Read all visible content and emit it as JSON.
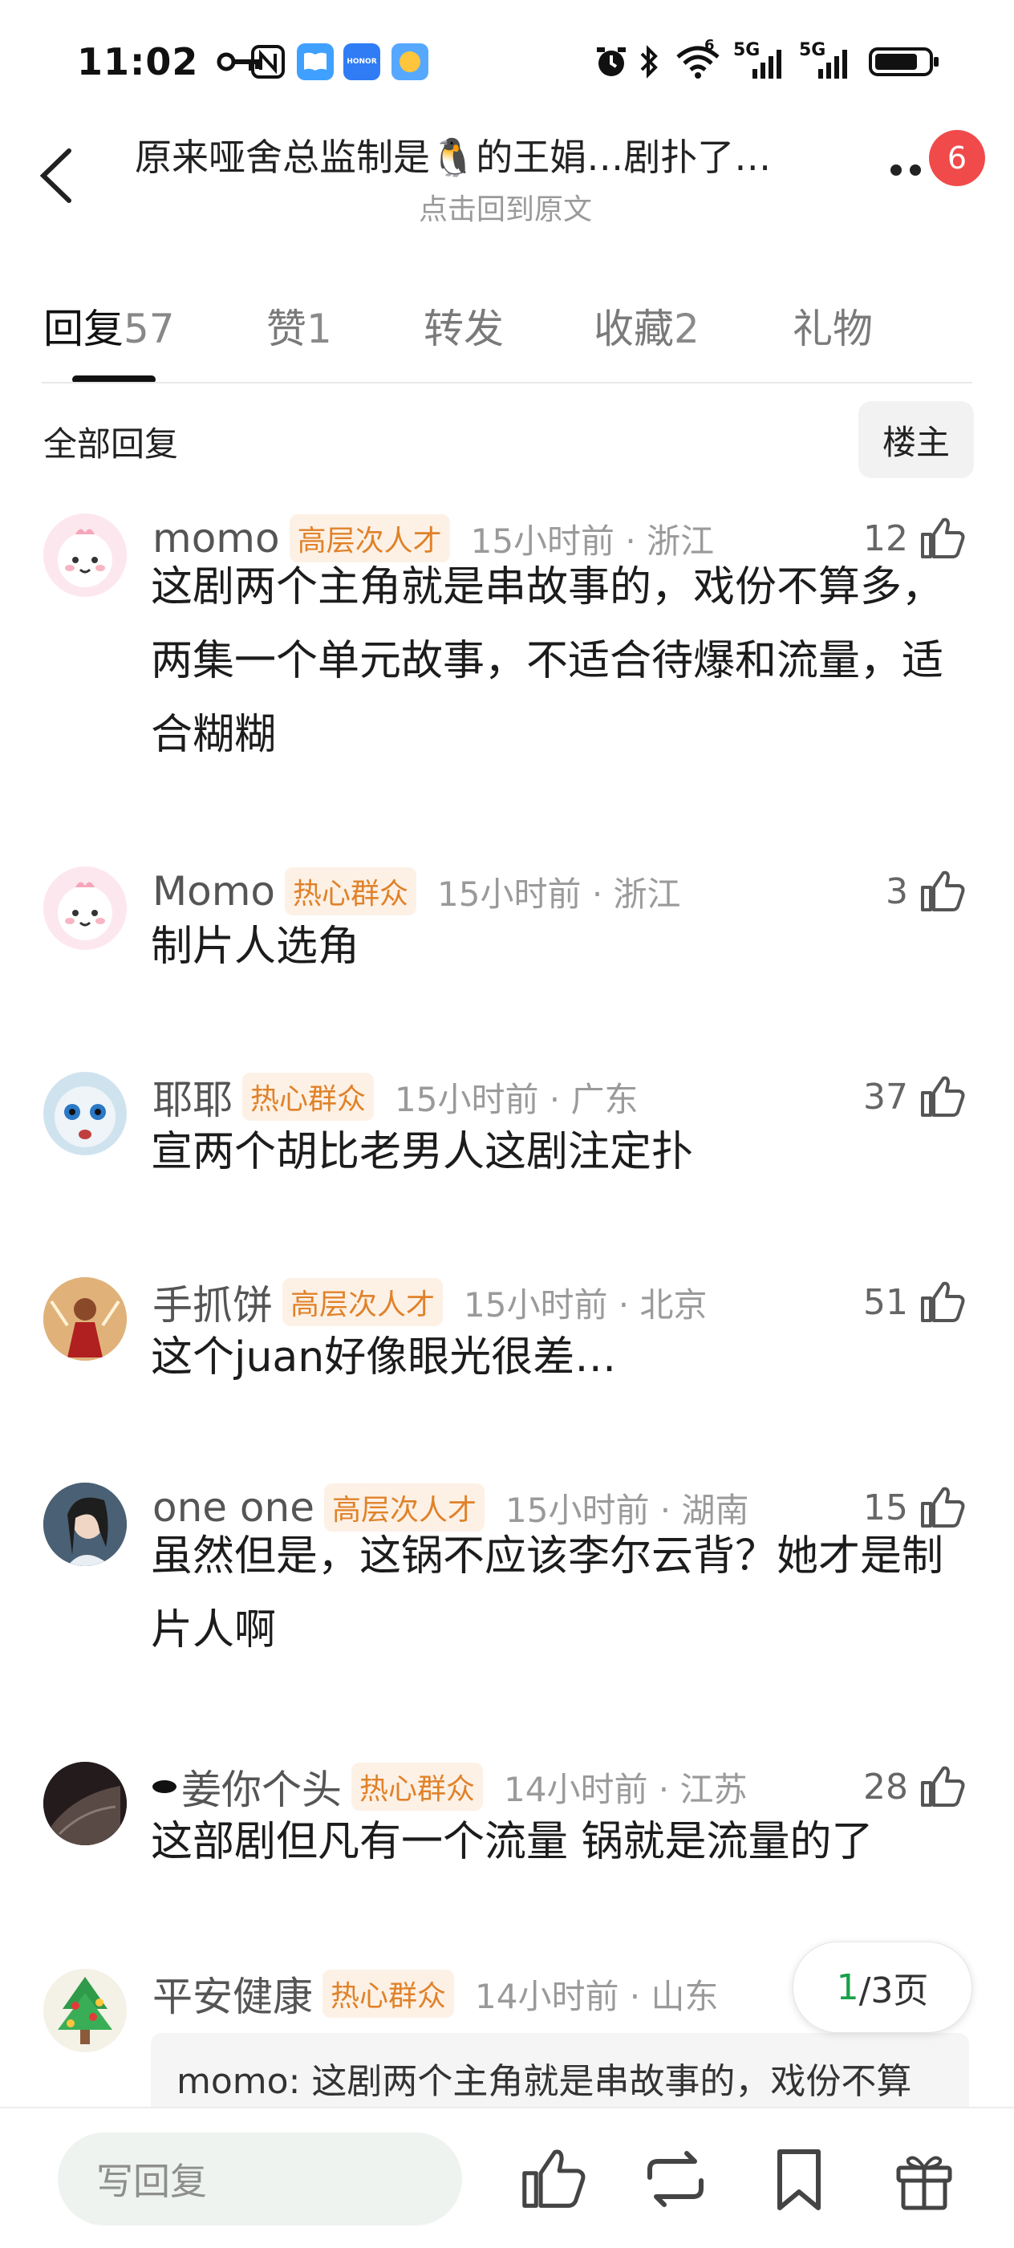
{
  "status_bar": {
    "time": "11:02",
    "network_1": "5G",
    "network_2": "5G",
    "sup_6": "6",
    "icons": [
      "key-icon",
      "nfc-icon",
      "book-app-icon",
      "honor-app-icon",
      "weather-app-icon",
      "alarm-icon",
      "bluetooth-icon",
      "wifi-icon",
      "signal-icon",
      "battery-icon"
    ]
  },
  "header": {
    "title": "原来哑舍总监制是🐧的王娟…剧扑了…",
    "subtitle": "点击回到原文",
    "badge": "6"
  },
  "tabs": [
    {
      "label": "回复",
      "count": "57"
    },
    {
      "label": "赞",
      "count": "1"
    },
    {
      "label": "转发",
      "count": ""
    },
    {
      "label": "收藏",
      "count": "2"
    },
    {
      "label": "礼物",
      "count": ""
    }
  ],
  "section": {
    "title": "全部回复",
    "owner_button": "楼主"
  },
  "comments": [
    {
      "user": "momo",
      "tag": "高层次人才",
      "time_loc": "15小时前 · 浙江",
      "likes": "12",
      "text": "这剧两个主角就是串故事的，戏份不算多，两集一个单元故事，不适合待爆和流量，适合糊糊"
    },
    {
      "user": "Momo",
      "tag": "热心群众",
      "time_loc": "15小时前 · 浙江",
      "likes": "3",
      "text": "制片人选角"
    },
    {
      "user": "耶耶",
      "tag": "热心群众",
      "time_loc": "15小时前 · 广东",
      "likes": "37",
      "text": "宣两个胡比老男人这剧注定扑"
    },
    {
      "user": "手抓饼",
      "tag": "高层次人才",
      "time_loc": "15小时前 · 北京",
      "likes": "51",
      "text": "这个juan好像眼光很差…"
    },
    {
      "user": "one one",
      "tag": "高层次人才",
      "time_loc": "15小时前 · 湖南",
      "likes": "15",
      "text": "虽然但是，这锅不应该李尔云背？她才是制片人啊"
    },
    {
      "user": "姜你个头",
      "tag": "热心群众",
      "time_loc": "14小时前 · 江苏",
      "likes": "28",
      "text": "这部剧但凡有一个流量 锅就是流量的了"
    },
    {
      "user": "平安健康",
      "tag": "热心群众",
      "time_loc": "14小时前 · 山东",
      "likes": "",
      "text": ""
    }
  ],
  "quote": "momo: 这剧两个主角就是串故事的，戏份不算",
  "pager": {
    "current": "1",
    "total": "/3页"
  },
  "bottom_bar": {
    "reply_placeholder": "写回复",
    "icons": [
      "like-icon",
      "repost-icon",
      "bookmark-icon",
      "gift-icon"
    ]
  },
  "colors": {
    "tag_text": "#e0822a",
    "tag_bg": "#fdf1e6",
    "badge": "#f04a4a",
    "pager_current": "#1aa04a"
  }
}
